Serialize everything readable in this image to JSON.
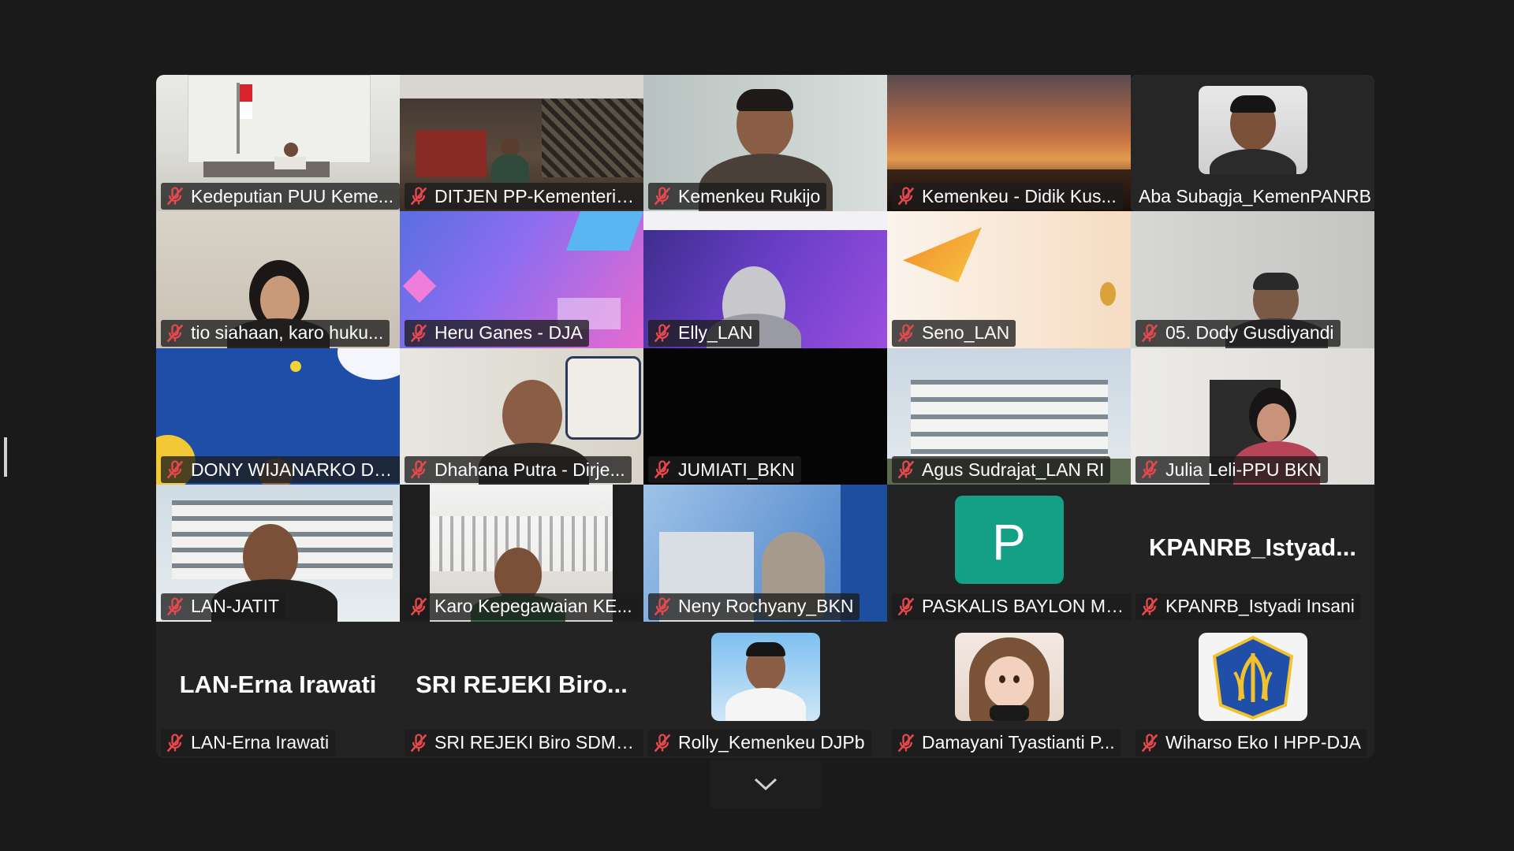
{
  "participants": [
    {
      "name": "Kedeputian PUU Keme...",
      "speaking": false
    },
    {
      "name": "DITJEN PP-Kementeria...",
      "speaking": false
    },
    {
      "name": "Kemenkeu Rukijo",
      "speaking": false
    },
    {
      "name": "Kemenkeu - Didik Kus...",
      "speaking": false
    },
    {
      "name": "Aba Subagja_KemenPANRB",
      "speaking": true
    },
    {
      "name": "tio siahaan, karo huku...",
      "speaking": false
    },
    {
      "name": "Heru Ganes - DJA",
      "speaking": false
    },
    {
      "name": "Elly_LAN",
      "speaking": false
    },
    {
      "name": "Seno_LAN",
      "speaking": false
    },
    {
      "name": "05. Dody Gusdiyandi",
      "speaking": false
    },
    {
      "name": "DONY WIJANARKO DJ...",
      "speaking": false
    },
    {
      "name": "Dhahana Putra - Dirje...",
      "speaking": false
    },
    {
      "name": "JUMIATI_BKN",
      "speaking": false
    },
    {
      "name": "Agus Sudrajat_LAN RI",
      "speaking": false
    },
    {
      "name": "Julia Leli-PPU BKN",
      "speaking": false
    },
    {
      "name": "LAN-JATIT",
      "speaking": false
    },
    {
      "name": "Karo Kepegawaian KE...",
      "speaking": false
    },
    {
      "name": "Neny Rochyany_BKN",
      "speaking": false
    },
    {
      "name": "PASKALIS BAYLON ME...",
      "speaking": false,
      "avatar_letter": "P"
    },
    {
      "name": "KPANRB_Istyadi Insani",
      "speaking": false,
      "display_name": "KPANRB_Istyad..."
    },
    {
      "name": "LAN-Erna Irawati",
      "speaking": false,
      "display_name": "LAN-Erna Irawati"
    },
    {
      "name": "SRI REJEKI Biro SDMO...",
      "speaking": false,
      "display_name": "SRI REJEKI Biro..."
    },
    {
      "name": "Rolly_Kemenkeu DJPb",
      "speaking": false
    },
    {
      "name": "Damayani Tyastianti P...",
      "speaking": false
    },
    {
      "name": "Wiharso Eko I HPP-DJA",
      "speaking": false
    }
  ],
  "colors": {
    "background": "#1a1a1a",
    "speaking_border": "#1fd07a",
    "muted_icon": "#e5484d",
    "avatar_p": "#14a085"
  }
}
